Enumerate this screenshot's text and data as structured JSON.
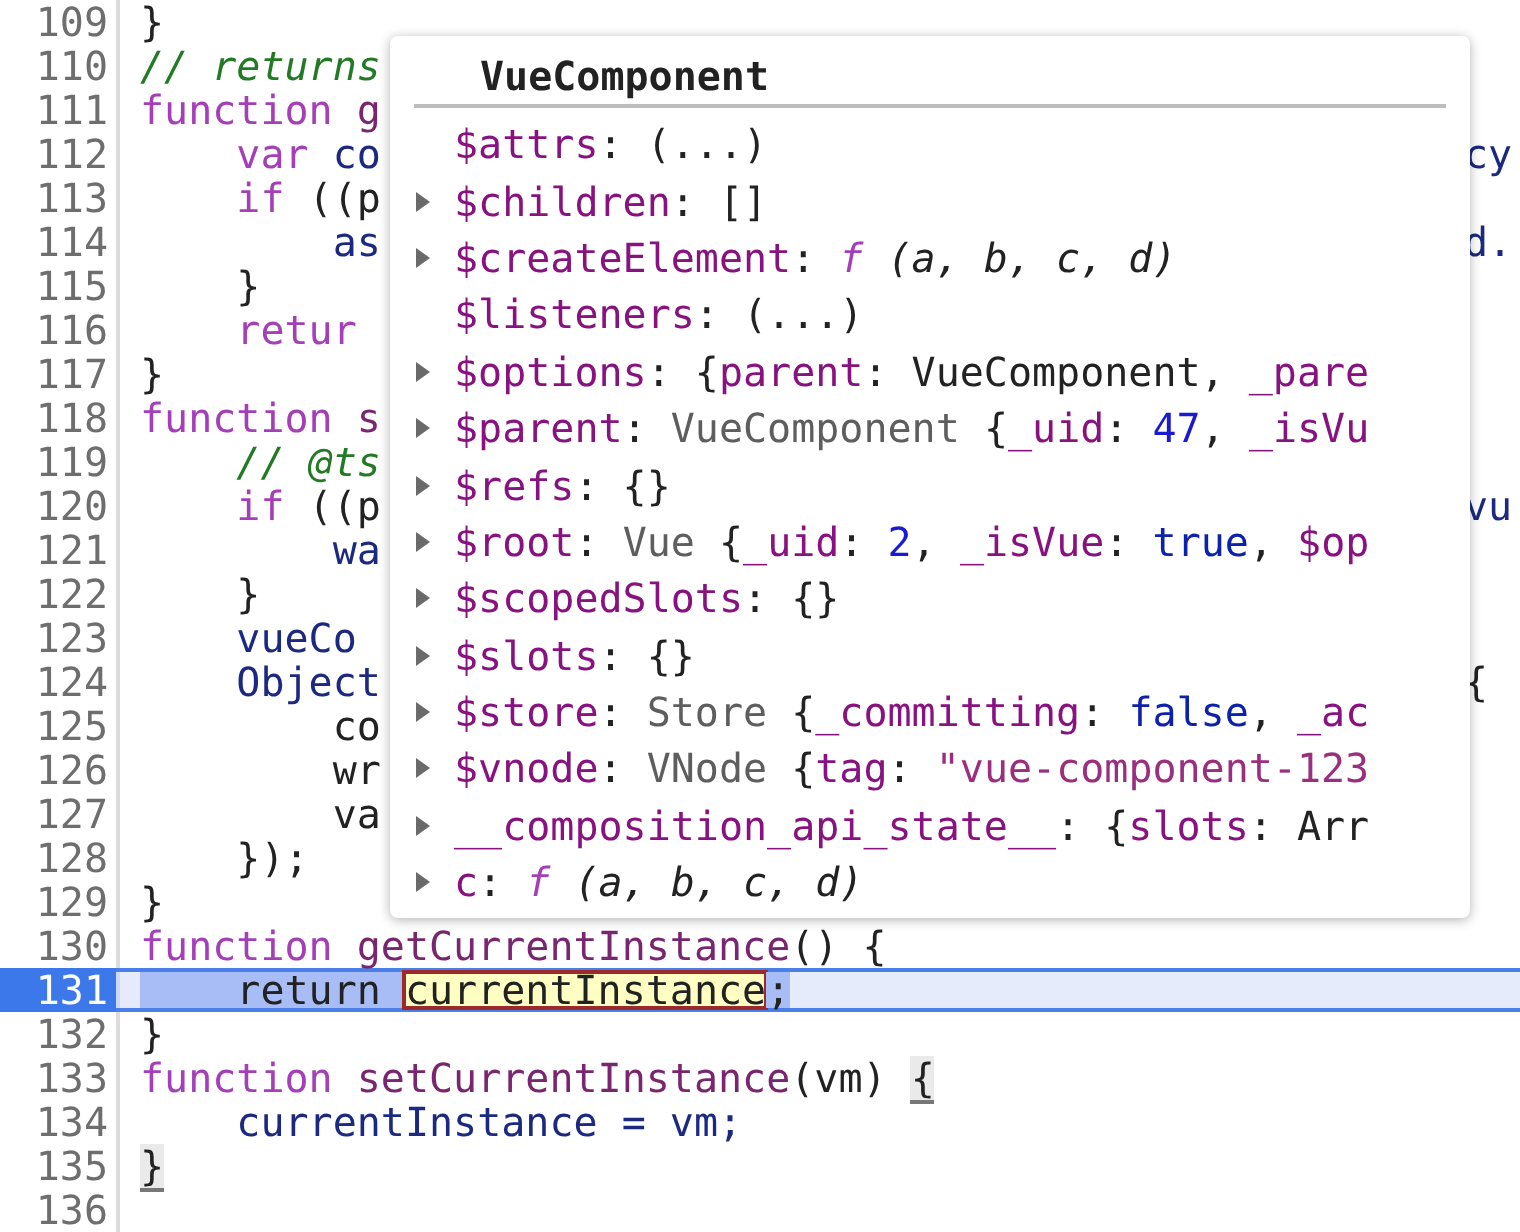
{
  "editor": {
    "lines": [
      {
        "number": "109",
        "current": false,
        "tokens": [
          {
            "text": "}",
            "kind": "plain"
          }
        ]
      },
      {
        "number": "110",
        "current": false,
        "tokens": [
          {
            "text": "// returns",
            "kind": "comment"
          }
        ]
      },
      {
        "number": "111",
        "current": false,
        "tokens": [
          {
            "text": "function",
            "kind": "kw"
          },
          {
            "text": " g",
            "kind": "def"
          }
        ]
      },
      {
        "number": "112",
        "current": false,
        "tokens": [
          {
            "text": "    var",
            "kind": "kw"
          },
          {
            "text": " co",
            "kind": "name"
          }
        ],
        "right": [
          {
            "text": "cy",
            "kind": "name"
          }
        ]
      },
      {
        "number": "113",
        "current": false,
        "tokens": [
          {
            "text": "    if",
            "kind": "kw"
          },
          {
            "text": " ((p",
            "kind": "plain"
          }
        ]
      },
      {
        "number": "114",
        "current": false,
        "tokens": [
          {
            "text": "        as",
            "kind": "name"
          }
        ],
        "right": [
          {
            "text": "d.",
            "kind": "name"
          }
        ]
      },
      {
        "number": "115",
        "current": false,
        "tokens": [
          {
            "text": "    }",
            "kind": "plain"
          }
        ]
      },
      {
        "number": "116",
        "current": false,
        "tokens": [
          {
            "text": "    retur",
            "kind": "kw"
          }
        ]
      },
      {
        "number": "117",
        "current": false,
        "tokens": [
          {
            "text": "}",
            "kind": "plain"
          }
        ]
      },
      {
        "number": "118",
        "current": false,
        "tokens": [
          {
            "text": "function",
            "kind": "kw"
          },
          {
            "text": " s",
            "kind": "def"
          }
        ]
      },
      {
        "number": "119",
        "current": false,
        "tokens": [
          {
            "text": "    // @ts",
            "kind": "comment"
          }
        ]
      },
      {
        "number": "120",
        "current": false,
        "tokens": [
          {
            "text": "    if",
            "kind": "kw"
          },
          {
            "text": " ((p",
            "kind": "plain"
          }
        ],
        "right": [
          {
            "text": "vu",
            "kind": "name"
          }
        ]
      },
      {
        "number": "121",
        "current": false,
        "tokens": [
          {
            "text": "        wa",
            "kind": "name"
          }
        ]
      },
      {
        "number": "122",
        "current": false,
        "tokens": [
          {
            "text": "    }",
            "kind": "plain"
          }
        ]
      },
      {
        "number": "123",
        "current": false,
        "tokens": [
          {
            "text": "    vueCo",
            "kind": "name"
          }
        ]
      },
      {
        "number": "124",
        "current": false,
        "tokens": [
          {
            "text": "    Object",
            "kind": "name"
          }
        ],
        "right": [
          {
            "text": "{",
            "kind": "plain"
          }
        ]
      },
      {
        "number": "125",
        "current": false,
        "tokens": [
          {
            "text": "        co",
            "kind": "plain"
          }
        ]
      },
      {
        "number": "126",
        "current": false,
        "tokens": [
          {
            "text": "        wr",
            "kind": "plain"
          }
        ]
      },
      {
        "number": "127",
        "current": false,
        "tokens": [
          {
            "text": "        va",
            "kind": "plain"
          }
        ]
      },
      {
        "number": "128",
        "current": false,
        "tokens": [
          {
            "text": "    });",
            "kind": "plain"
          }
        ]
      },
      {
        "number": "129",
        "current": false,
        "tokens": [
          {
            "text": "}",
            "kind": "plain"
          }
        ]
      },
      {
        "number": "130",
        "current": false,
        "tokens": [
          {
            "text": "function",
            "kind": "kw"
          },
          {
            "text": " getCurrentInstance",
            "kind": "def"
          },
          {
            "text": "() {",
            "kind": "plain"
          }
        ]
      },
      {
        "number": "131",
        "current": true,
        "tokens": [
          {
            "text": "    return ",
            "kind": "selection"
          },
          {
            "text": "currentInstance",
            "kind": "hover"
          },
          {
            "text": ";",
            "kind": "selection"
          }
        ]
      },
      {
        "number": "132",
        "current": false,
        "tokens": [
          {
            "text": "}",
            "kind": "plain"
          }
        ]
      },
      {
        "number": "133",
        "current": false,
        "tokens": [
          {
            "text": "function",
            "kind": "kw"
          },
          {
            "text": " setCurrentInstance",
            "kind": "def"
          },
          {
            "text": "(vm) ",
            "kind": "plain"
          },
          {
            "text": "{",
            "kind": "match"
          }
        ]
      },
      {
        "number": "134",
        "current": false,
        "tokens": [
          {
            "text": "    currentInstance = vm;",
            "kind": "name"
          }
        ]
      },
      {
        "number": "135",
        "current": false,
        "tokens": [
          {
            "text": "}",
            "kind": "match"
          }
        ]
      },
      {
        "number": "136",
        "current": false
      }
    ]
  },
  "popover": {
    "title": "VueComponent",
    "properties": [
      {
        "name": "$attrs",
        "expandable": false,
        "value": [
          {
            "text": ": (...)",
            "kind": "plain"
          }
        ]
      },
      {
        "name": "$children",
        "expandable": true,
        "value": [
          {
            "text": ": []",
            "kind": "plain"
          }
        ]
      },
      {
        "name": "$createElement",
        "expandable": true,
        "value": [
          {
            "text": ": ",
            "kind": "plain"
          },
          {
            "text": "f",
            "kind": "fn"
          },
          {
            "text": " (a, b, c, d)",
            "kind": "italic"
          }
        ]
      },
      {
        "name": "$listeners",
        "expandable": false,
        "value": [
          {
            "text": ": (...)",
            "kind": "plain"
          }
        ]
      },
      {
        "name": "$options",
        "expandable": true,
        "value": [
          {
            "text": ": {",
            "kind": "plain"
          },
          {
            "text": "parent",
            "kind": "key"
          },
          {
            "text": ": VueComponent, ",
            "kind": "plain"
          },
          {
            "text": "_pare",
            "kind": "key"
          }
        ]
      },
      {
        "name": "$parent",
        "expandable": true,
        "value": [
          {
            "text": ": ",
            "kind": "plain"
          },
          {
            "text": "VueComponent ",
            "kind": "cls"
          },
          {
            "text": "{",
            "kind": "plain"
          },
          {
            "text": "_uid",
            "kind": "key"
          },
          {
            "text": ": ",
            "kind": "plain"
          },
          {
            "text": "47",
            "kind": "num"
          },
          {
            "text": ", ",
            "kind": "plain"
          },
          {
            "text": "_isVu",
            "kind": "key"
          }
        ]
      },
      {
        "name": "$refs",
        "expandable": true,
        "value": [
          {
            "text": ": {}",
            "kind": "plain"
          }
        ]
      },
      {
        "name": "$root",
        "expandable": true,
        "value": [
          {
            "text": ": ",
            "kind": "plain"
          },
          {
            "text": "Vue ",
            "kind": "cls"
          },
          {
            "text": "{",
            "kind": "plain"
          },
          {
            "text": "_uid",
            "kind": "key"
          },
          {
            "text": ": ",
            "kind": "plain"
          },
          {
            "text": "2",
            "kind": "num"
          },
          {
            "text": ", ",
            "kind": "plain"
          },
          {
            "text": "_isVue",
            "kind": "key"
          },
          {
            "text": ": ",
            "kind": "plain"
          },
          {
            "text": "true",
            "kind": "bool"
          },
          {
            "text": ", ",
            "kind": "plain"
          },
          {
            "text": "$op",
            "kind": "key"
          }
        ]
      },
      {
        "name": "$scopedSlots",
        "expandable": true,
        "value": [
          {
            "text": ": {}",
            "kind": "plain"
          }
        ]
      },
      {
        "name": "$slots",
        "expandable": true,
        "value": [
          {
            "text": ": {}",
            "kind": "plain"
          }
        ]
      },
      {
        "name": "$store",
        "expandable": true,
        "value": [
          {
            "text": ": ",
            "kind": "plain"
          },
          {
            "text": "Store ",
            "kind": "cls"
          },
          {
            "text": "{",
            "kind": "plain"
          },
          {
            "text": "_committing",
            "kind": "key"
          },
          {
            "text": ": ",
            "kind": "plain"
          },
          {
            "text": "false",
            "kind": "bool"
          },
          {
            "text": ", ",
            "kind": "plain"
          },
          {
            "text": "_ac",
            "kind": "key"
          }
        ]
      },
      {
        "name": "$vnode",
        "expandable": true,
        "value": [
          {
            "text": ": ",
            "kind": "plain"
          },
          {
            "text": "VNode ",
            "kind": "cls"
          },
          {
            "text": "{",
            "kind": "plain"
          },
          {
            "text": "tag",
            "kind": "key"
          },
          {
            "text": ": ",
            "kind": "plain"
          },
          {
            "text": "\"vue-component-123",
            "kind": "str"
          }
        ]
      },
      {
        "name": "__composition_api_state__",
        "expandable": true,
        "value": [
          {
            "text": ": {",
            "kind": "plain"
          },
          {
            "text": "slots",
            "kind": "key"
          },
          {
            "text": ": Arr",
            "kind": "plain"
          }
        ]
      },
      {
        "name": "c",
        "expandable": true,
        "value": [
          {
            "text": ": ",
            "kind": "plain"
          },
          {
            "text": "f",
            "kind": "fn"
          },
          {
            "text": " (a, b, c, d)",
            "kind": "italic"
          }
        ]
      }
    ]
  }
}
